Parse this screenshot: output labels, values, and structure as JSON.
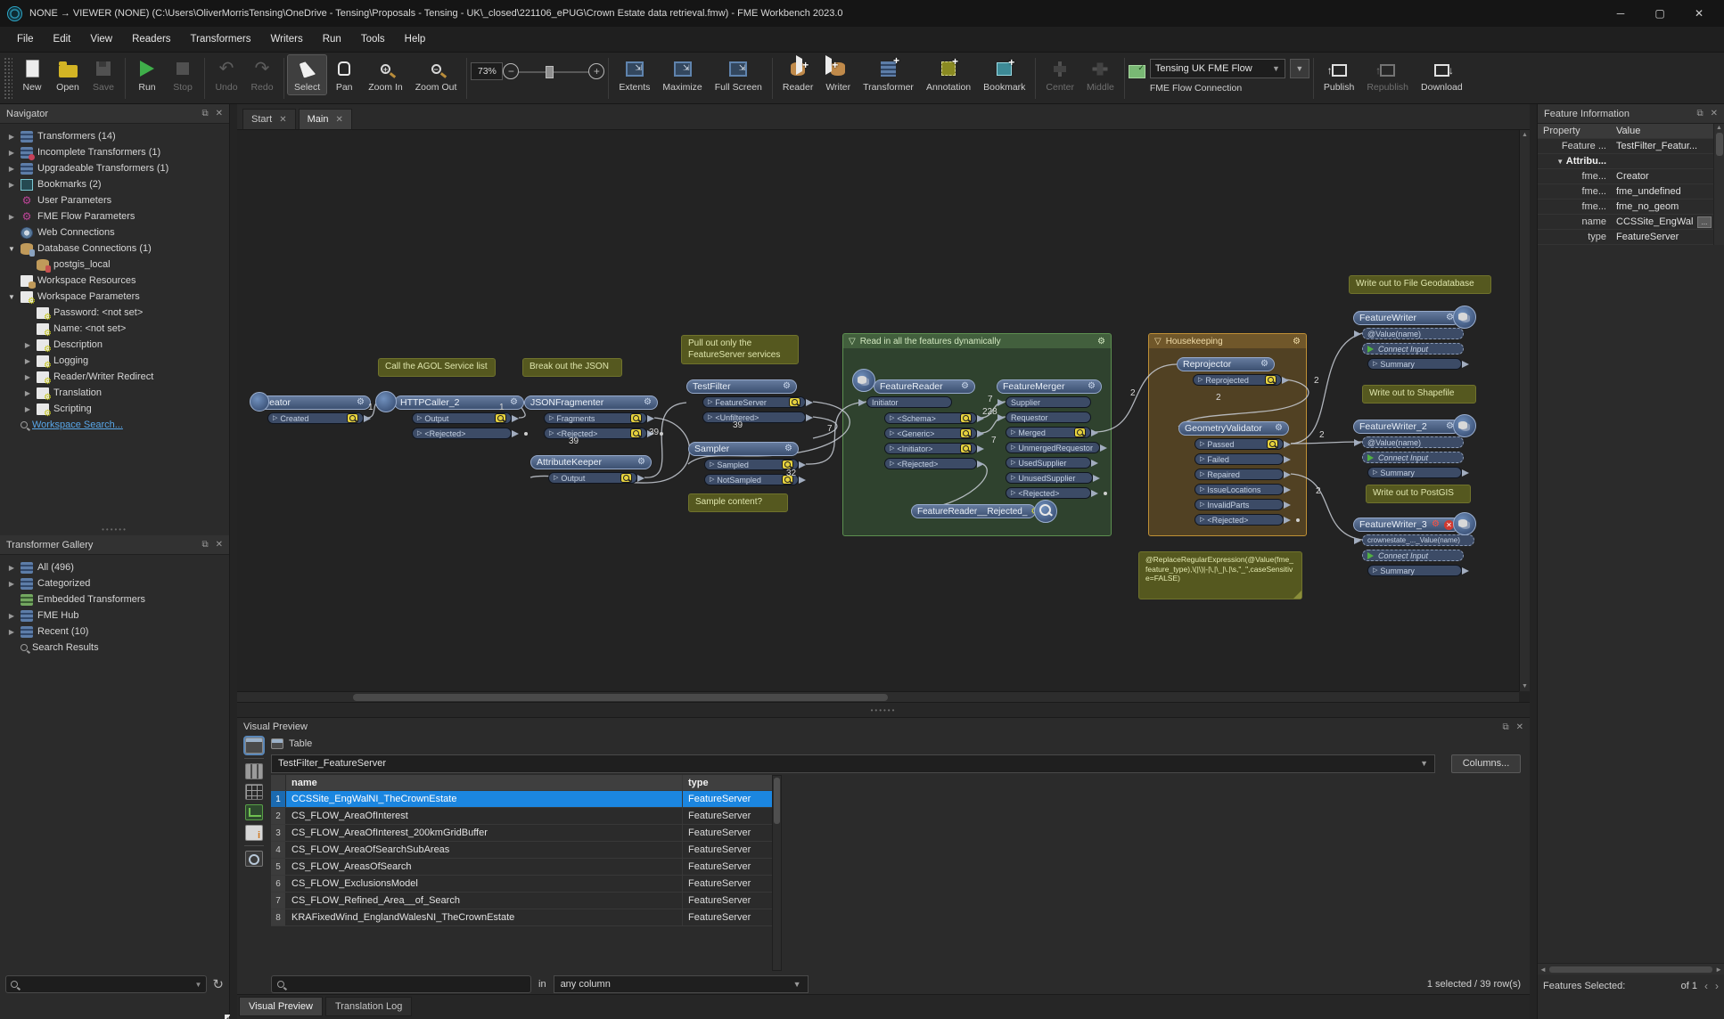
{
  "window": {
    "title": "NONE → VIEWER (NONE) (C:\\Users\\OliverMorrisTensing\\OneDrive - Tensing\\Proposals - Tensing - UK\\_closed\\221106_ePUG\\Crown Estate data retrieval.fmw) - FME Workbench 2023.0"
  },
  "menu": [
    "File",
    "Edit",
    "View",
    "Readers",
    "Transformers",
    "Writers",
    "Run",
    "Tools",
    "Help"
  ],
  "toolbar": {
    "new": "New",
    "open": "Open",
    "save": "Save",
    "run": "Run",
    "stop": "Stop",
    "undo": "Undo",
    "redo": "Redo",
    "select": "Select",
    "pan": "Pan",
    "zoom_in": "Zoom In",
    "zoom_out": "Zoom Out",
    "zoom_value": "73%",
    "extents": "Extents",
    "maximize": "Maximize",
    "full_screen": "Full Screen",
    "reader": "Reader",
    "writer": "Writer",
    "transformer": "Transformer",
    "annotation": "Annotation",
    "bookmark": "Bookmark",
    "center": "Center",
    "middle": "Middle",
    "flow_connection_value": "Tensing UK FME Flow",
    "flow_connection_label": "FME Flow Connection",
    "publish": "Publish",
    "republish": "Republish",
    "download": "Download"
  },
  "navigator": {
    "title": "Navigator",
    "items": [
      {
        "label": "Transformers (14)"
      },
      {
        "label": "Incomplete Transformers (1)"
      },
      {
        "label": "Upgradeable Transformers (1)"
      },
      {
        "label": "Bookmarks (2)"
      },
      {
        "label": "User Parameters"
      },
      {
        "label": "FME Flow Parameters"
      },
      {
        "label": "Web Connections"
      },
      {
        "label": "Database Connections (1)"
      },
      {
        "label": "postgis_local"
      },
      {
        "label": "Workspace Resources"
      },
      {
        "label": "Workspace Parameters"
      },
      {
        "label": "Password: <not set>"
      },
      {
        "label": "Name: <not set>"
      },
      {
        "label": "Description"
      },
      {
        "label": "Logging"
      },
      {
        "label": "Reader/Writer Redirect"
      },
      {
        "label": "Translation"
      },
      {
        "label": "Scripting"
      },
      {
        "label": "Workspace Search..."
      }
    ]
  },
  "gallery": {
    "title": "Transformer Gallery",
    "items": [
      {
        "label": "All (496)"
      },
      {
        "label": "Categorized"
      },
      {
        "label": "Embedded Transformers"
      },
      {
        "label": "FME Hub"
      },
      {
        "label": "Recent (10)"
      },
      {
        "label": "Search Results"
      }
    ]
  },
  "tabs": {
    "start": "Start",
    "main": "Main"
  },
  "canvas": {
    "bookmarks": {
      "read": "Read in all the features dynamically",
      "housekeeping": "Housekeeping"
    },
    "annotations": {
      "agol": "Call the AGOL Service list",
      "json": "Break out the JSON",
      "pull": "Pull out only the FeatureServer services",
      "sample": "Sample content?",
      "gdb": "Write out to File Geodatabase",
      "shp": "Write out to Shapefile",
      "postgis": "Write out to PostGIS",
      "regex": "@ReplaceRegularExpression(@Value(fme_feature_type),\\(|\\)|-|\\,|\\_|\\.|\\s,\"_\",caseSensitive=FALSE)"
    },
    "nodes": {
      "creator": {
        "title": "Creator",
        "p0": "Created"
      },
      "httpcaller": {
        "title": "HTTPCaller_2",
        "p0": "Output",
        "p1": "<Rejected>"
      },
      "jsonfragmenter": {
        "title": "JSONFragmenter",
        "p0": "Fragments",
        "p1": "<Rejected>"
      },
      "attributekeeper": {
        "title": "AttributeKeeper",
        "p0": "Output"
      },
      "testfilter": {
        "title": "TestFilter",
        "p0": "FeatureServer",
        "p1": "<Unfiltered>"
      },
      "sampler": {
        "title": "Sampler",
        "p0": "Sampled",
        "p1": "NotSampled"
      },
      "featurereader": {
        "title": "FeatureReader",
        "p0": "Initiator",
        "p1": "<Schema>",
        "p2": "<Generic>",
        "p3": "<Initiator>",
        "p4": "<Rejected>"
      },
      "featuremerger": {
        "title": "FeatureMerger",
        "p0": "Supplier",
        "p1": "Requestor",
        "p2": "Merged",
        "p3": "UnmergedRequestor",
        "p4": "UsedSupplier",
        "p5": "UnusedSupplier",
        "p6": "<Rejected>"
      },
      "rejected_inspector": {
        "title": "FeatureReader__Rejected_"
      },
      "reprojector": {
        "title": "Reprojector",
        "p0": "Reprojected"
      },
      "geometryvalidator": {
        "title": "GeometryValidator",
        "p0": "Passed",
        "p1": "Failed",
        "p2": "Repaired",
        "p3": "IssueLocations",
        "p4": "InvalidParts",
        "p5": "<Rejected>"
      },
      "featurewriter": {
        "title": "FeatureWriter",
        "p0": "@Value(name)",
        "p1": "Connect Input",
        "p2": "Summary"
      },
      "featurewriter2": {
        "title": "FeatureWriter_2",
        "p0": "@Value(name)",
        "p1": "Connect Input",
        "p2": "Summary"
      },
      "featurewriter3": {
        "title": "FeatureWriter_3",
        "p0": "crownestate_..._Value(name)",
        "p1": "Connect Input",
        "p2": "Summary"
      }
    },
    "edge_labels": [
      "1",
      "1",
      "39",
      "39",
      "39",
      "32",
      "7",
      "7",
      "228",
      "7",
      "2",
      "2",
      "2",
      "2",
      "2"
    ]
  },
  "preview": {
    "title": "Visual Preview",
    "table_label": "Table",
    "feature_type": "TestFilter_FeatureServer",
    "columns_button": "Columns...",
    "columns": {
      "name": "name",
      "type": "type"
    },
    "rows": [
      {
        "n": "1",
        "name": "CCSSite_EngWalNI_TheCrownEstate",
        "type": "FeatureServer"
      },
      {
        "n": "2",
        "name": "CS_FLOW_AreaOfInterest",
        "type": "FeatureServer"
      },
      {
        "n": "3",
        "name": "CS_FLOW_AreaOfInterest_200kmGridBuffer",
        "type": "FeatureServer"
      },
      {
        "n": "4",
        "name": "CS_FLOW_AreaOfSearchSubAreas",
        "type": "FeatureServer"
      },
      {
        "n": "5",
        "name": "CS_FLOW_AreasOfSearch",
        "type": "FeatureServer"
      },
      {
        "n": "6",
        "name": "CS_FLOW_ExclusionsModel",
        "type": "FeatureServer"
      },
      {
        "n": "7",
        "name": "CS_FLOW_Refined_Area__of_Search",
        "type": "FeatureServer"
      },
      {
        "n": "8",
        "name": "KRAFixedWind_EnglandWalesNI_TheCrownEstate",
        "type": "FeatureServer"
      }
    ],
    "search": {
      "in_label": "in",
      "column_filter": "any column"
    },
    "selection_status": "1 selected / 39 row(s)"
  },
  "feature_info": {
    "title": "Feature Information",
    "columns": {
      "property": "Property",
      "value": "Value"
    },
    "rows": [
      {
        "property": "Feature ...",
        "value": "TestFilter_Featur..."
      },
      {
        "property": "Attribu...",
        "value": ""
      },
      {
        "property": "fme...",
        "value": "Creator"
      },
      {
        "property": "fme...",
        "value": "fme_undefined"
      },
      {
        "property": "fme...",
        "value": "fme_no_geom"
      },
      {
        "property": "name",
        "value": "CCSSite_EngWal"
      },
      {
        "property": "type",
        "value": "FeatureServer"
      }
    ],
    "footer": {
      "label": "Features Selected:",
      "of_label": "of 1"
    }
  },
  "bottom_tabs": {
    "visual_preview": "Visual Preview",
    "translation_log": "Translation Log"
  }
}
